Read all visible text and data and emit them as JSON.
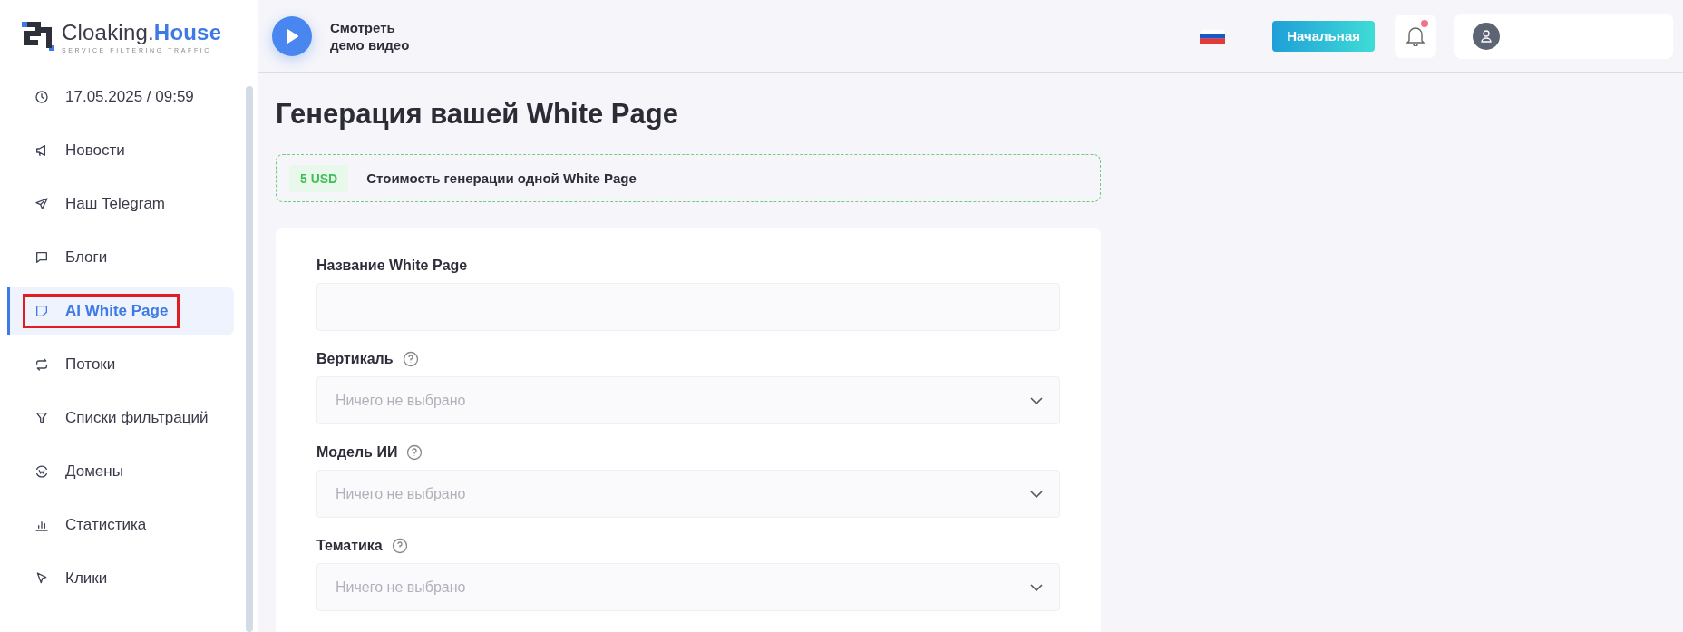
{
  "logo": {
    "name": "Cloaking.",
    "accent": "House",
    "tagline": "SERVICE FILTERING TRAFFIC"
  },
  "sidebar": {
    "items": [
      {
        "kind": "clock",
        "label": "17.05.2025 / 09:59",
        "selected": false,
        "annotated": false
      },
      {
        "kind": "megaphone",
        "label": "Новости",
        "selected": false,
        "annotated": false
      },
      {
        "kind": "plane",
        "label": "Наш Telegram",
        "selected": false,
        "annotated": false
      },
      {
        "kind": "chat",
        "label": "Блоги",
        "selected": false,
        "annotated": false
      },
      {
        "kind": "page",
        "label": "AI White Page",
        "selected": true,
        "annotated": true
      },
      {
        "kind": "repeat",
        "label": "Потоки",
        "selected": false,
        "annotated": false
      },
      {
        "kind": "filter",
        "label": "Списки фильтраций",
        "selected": false,
        "annotated": false
      },
      {
        "kind": "web",
        "label": "Домены",
        "selected": false,
        "annotated": false
      },
      {
        "kind": "chart",
        "label": "Статистика",
        "selected": false,
        "annotated": false
      },
      {
        "kind": "cursor",
        "label": "Клики",
        "selected": false,
        "annotated": false
      }
    ]
  },
  "header": {
    "demo": {
      "line1": "Смотреть",
      "line2": "демо видео"
    },
    "home_button": "Начальная",
    "notifications": {
      "unread": true
    }
  },
  "page": {
    "title": "Генерация вашей White Page",
    "price": {
      "badge": "5 USD",
      "text": "Стоимость генерации одной White Page"
    },
    "form": {
      "fields": [
        {
          "kind": "text",
          "label": "Название White Page",
          "help": false
        },
        {
          "kind": "select",
          "label": "Вертикаль",
          "help": true,
          "placeholder": "Ничего не выбрано"
        },
        {
          "kind": "select",
          "label": "Модель ИИ",
          "help": true,
          "placeholder": "Ничего не выбрано"
        },
        {
          "kind": "select",
          "label": "Тематика",
          "help": true,
          "placeholder": "Ничего не выбрано"
        }
      ]
    }
  }
}
